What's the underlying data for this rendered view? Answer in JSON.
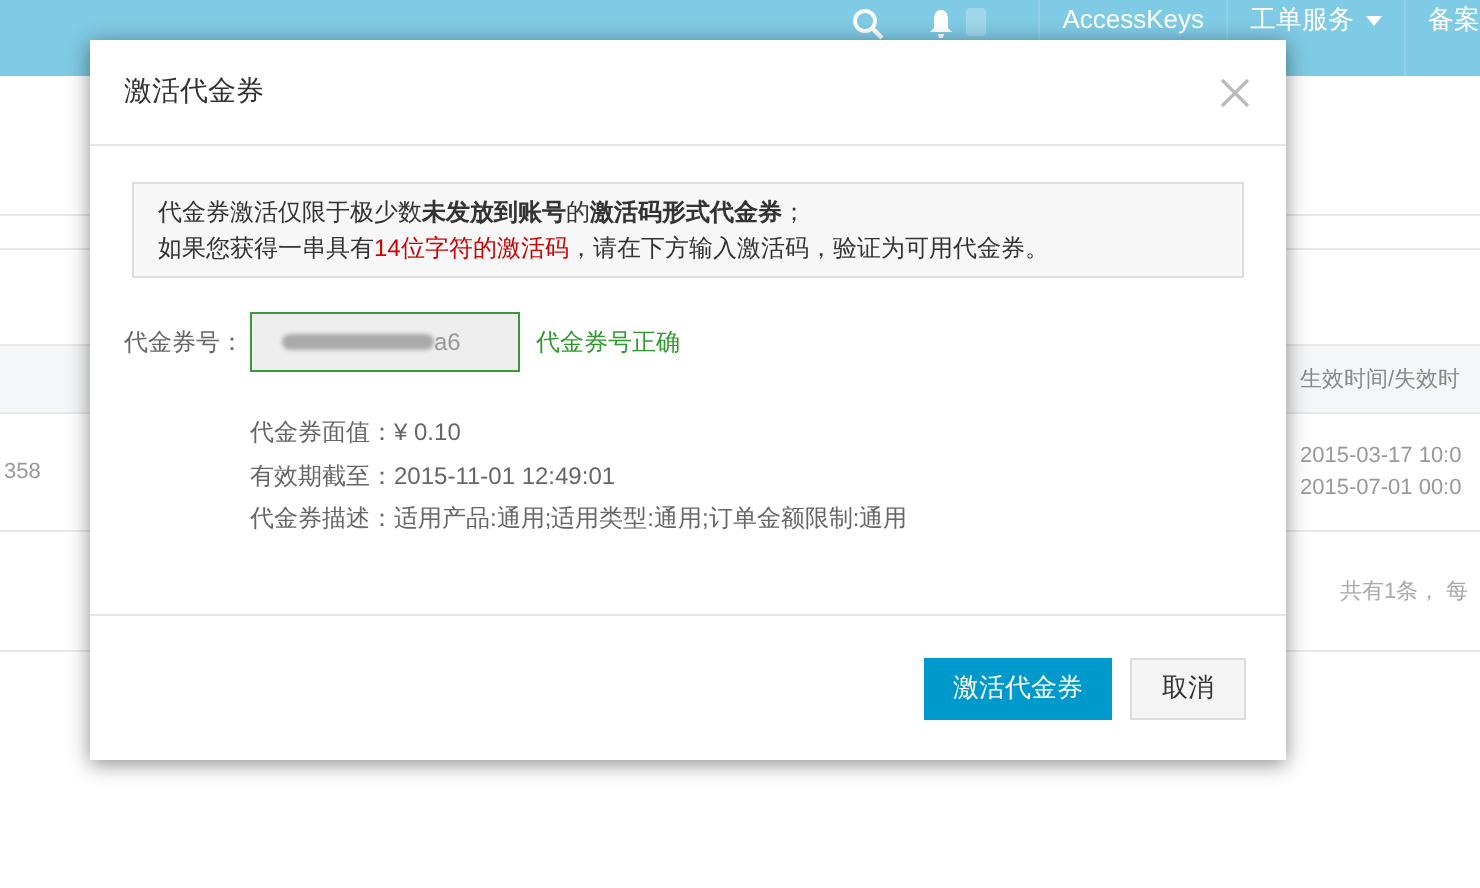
{
  "top_bar": {
    "links": [
      {
        "label": "AccessKeys",
        "dropdown": false
      },
      {
        "label": "工单服务",
        "dropdown": true
      },
      {
        "label": "备案",
        "dropdown": false
      }
    ]
  },
  "background_page": {
    "table": {
      "header": "生效时间/失效时",
      "rows": [
        {
          "column_1": "358",
          "column_2": [
            "2015-03-17 10:0",
            "2015-07-01 00:0"
          ]
        }
      ]
    },
    "pagination": "共有1条， 每"
  },
  "dialog": {
    "title": "激活代金券",
    "notice": {
      "line_1": "代金券激活仅限于极少数**未发放到账号**的**激活码形式代金券**；",
      "line_2": [
        {
          "text": "如果您获得一串具有",
          "kind": "plain"
        },
        {
          "text": "14位字符的激活码",
          "kind": "highlight"
        },
        {
          "text": "，请在下方输入激活码，验证为可用代金券。",
          "kind": "plain"
        }
      ]
    },
    "code_field": {
      "label": "代金券号：",
      "value": "a6",
      "valid": true
    },
    "validation_message": "代金券号正确",
    "details": [
      "代金券面值：¥ 0.10",
      "有效期截至：2015-11-01 12:49:01",
      "代金券描述：适用产品:通用;适用类型:通用;订单金额限制:通用"
    ],
    "buttons": [
      {
        "label": "激活代金券",
        "kind": "primary"
      },
      {
        "label": "取消",
        "kind": "secondary"
      }
    ]
  }
}
